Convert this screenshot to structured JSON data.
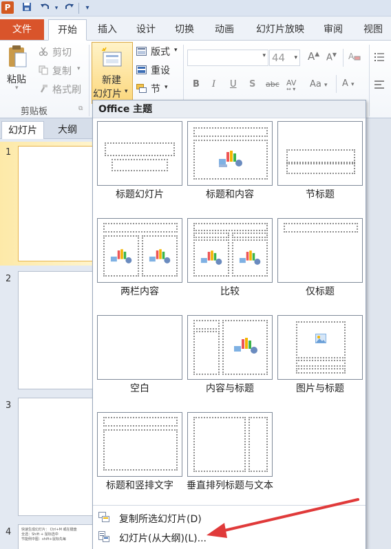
{
  "app": {
    "logo": "P"
  },
  "quick_access": {
    "save_icon": "save-icon",
    "undo_icon": "undo-icon",
    "redo_icon": "redo-icon",
    "customize_icon": "customize-icon"
  },
  "tabs": {
    "file": "文件",
    "items": [
      "开始",
      "插入",
      "设计",
      "切换",
      "动画",
      "幻灯片放映",
      "审阅",
      "视图"
    ],
    "active": "开始"
  },
  "ribbon": {
    "clipboard": {
      "paste": "粘贴",
      "cut": "剪切",
      "copy": "复制",
      "format_painter": "格式刷",
      "group_label": "剪贴板"
    },
    "slides": {
      "new_slide_line1": "新建",
      "new_slide_line2": "幻灯片",
      "layout": "版式",
      "reset": "重设",
      "section": "节"
    },
    "font": {
      "size": "44",
      "grow": "A",
      "shrink": "A",
      "bold": "B",
      "italic": "I",
      "underline": "U",
      "shadow": "S",
      "strike": "abc",
      "spacing": "AV",
      "case": "Aa",
      "color": "A"
    }
  },
  "left_panel": {
    "tabs": [
      "幻灯片",
      "大纲"
    ],
    "slides": [
      {
        "num": "1",
        "selected": true
      },
      {
        "num": "2",
        "selected": false
      },
      {
        "num": "3",
        "selected": false
      },
      {
        "num": "4",
        "selected": false
      }
    ],
    "slide4_text": [
      "快速生成幻灯片： Ctrl+M 或在键盘",
      "全选：Shift + 鼠标选中",
      "节能例中图：shift+鼠标先每"
    ]
  },
  "gallery": {
    "header": "Office 主题",
    "layouts": [
      "标题幻灯片",
      "标题和内容",
      "节标题",
      "两栏内容",
      "比较",
      "仅标题",
      "空白",
      "内容与标题",
      "图片与标题",
      "标题和竖排文字",
      "垂直排列标题与文本"
    ],
    "menu": [
      {
        "label": "复制所选幻灯片(D)",
        "icon": "duplicate-slides-icon"
      },
      {
        "label": "幻灯片(从大纲)(L)...",
        "icon": "slides-from-outline-icon"
      }
    ]
  },
  "colors": {
    "file_tab": "#d9542b",
    "selection": "#fcd77c",
    "arrow": "#e03a3a"
  }
}
